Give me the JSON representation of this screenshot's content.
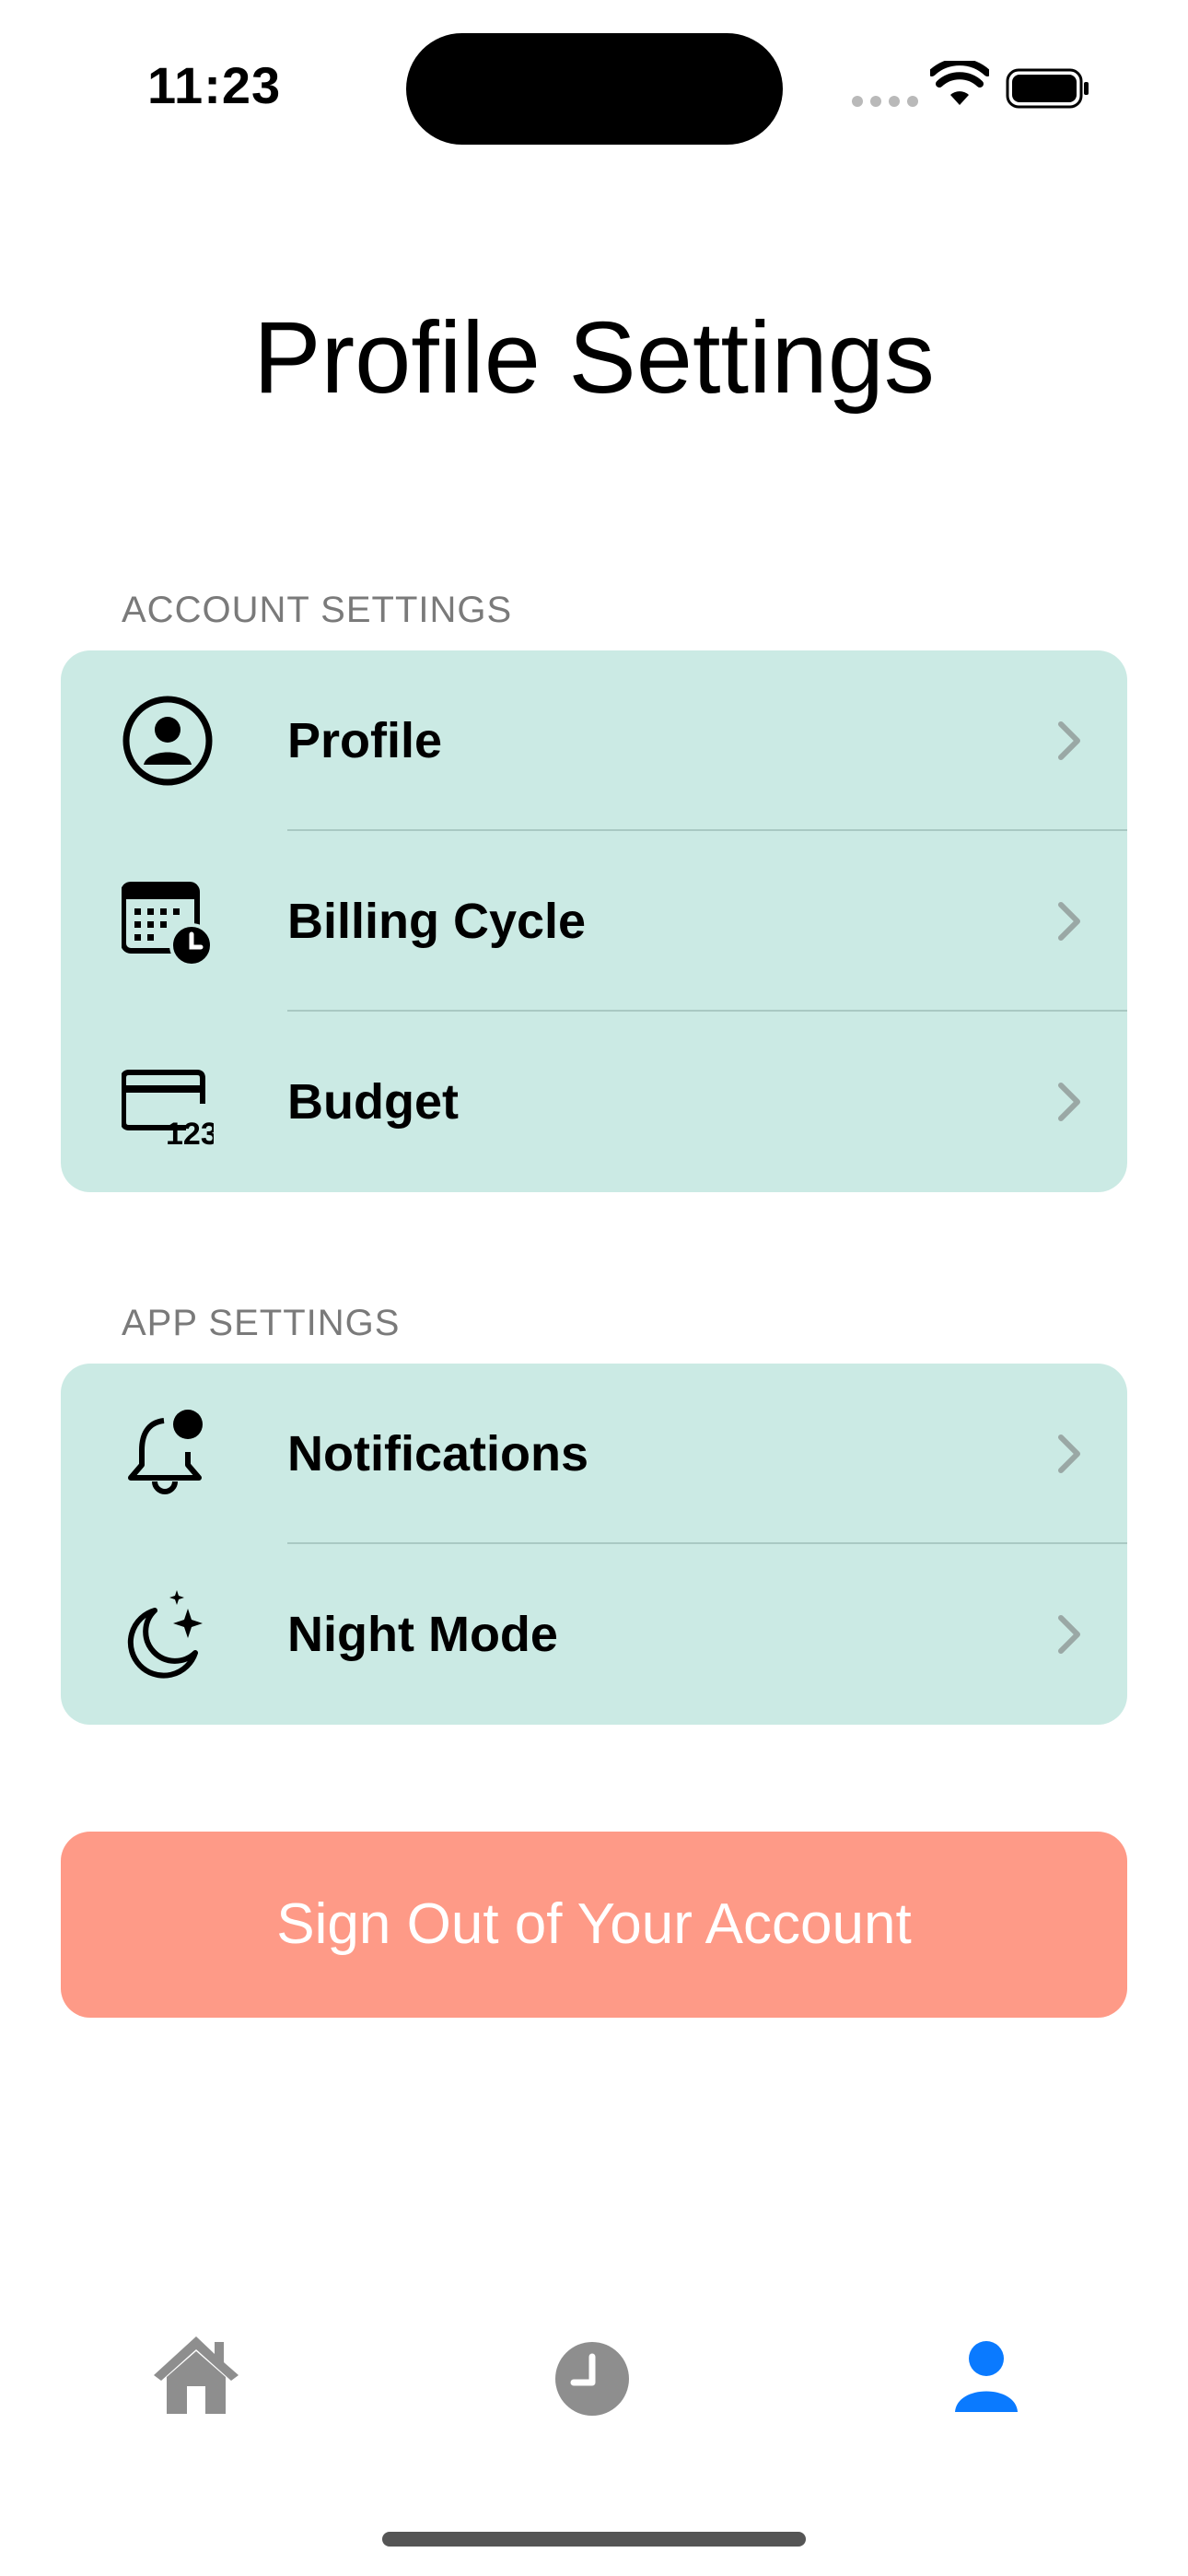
{
  "status_bar": {
    "time": "11:23"
  },
  "page": {
    "title": "Profile Settings"
  },
  "sections": {
    "account": {
      "header": "ACCOUNT SETTINGS",
      "items": [
        {
          "label": "Profile",
          "icon": "person-circle-icon"
        },
        {
          "label": "Billing Cycle",
          "icon": "calendar-clock-icon"
        },
        {
          "label": "Budget",
          "icon": "credit-card-123-icon"
        }
      ]
    },
    "app": {
      "header": "APP SETTINGS",
      "items": [
        {
          "label": "Notifications",
          "icon": "bell-badge-icon"
        },
        {
          "label": "Night Mode",
          "icon": "moon-stars-icon"
        }
      ]
    }
  },
  "signout": {
    "label": "Sign Out of Your Account"
  },
  "tab_bar": {
    "items": [
      {
        "icon": "house-icon",
        "selected": false
      },
      {
        "icon": "clock-icon",
        "selected": false
      },
      {
        "icon": "person-icon",
        "selected": true
      }
    ]
  },
  "colors": {
    "card_bg": "#cbeae4",
    "signout_bg": "#fe9a87",
    "tab_selected": "#0a7aff",
    "tab_unselected": "#8e8e8e"
  }
}
